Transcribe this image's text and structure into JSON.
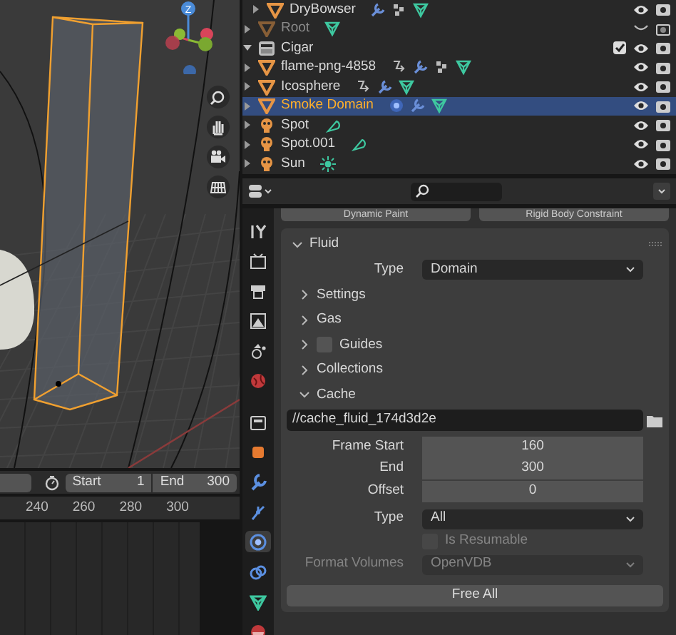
{
  "viewport": {
    "gizmo_label": "Z"
  },
  "timeline": {
    "start_label": "Start",
    "start": "1",
    "end_label": "End",
    "end": "300",
    "ruler": [
      "240",
      "260",
      "280",
      "300"
    ]
  },
  "outliner": [
    {
      "kind": "cut_off",
      "children": [
        {
          "kind": "cut_off",
          "children": [
            {
              "name": "DryBowser",
              "kind": "mesh",
              "hidden": false,
              "selected": false,
              "expanded": false,
              "icons": [
                {
                  "kind": "wrench"
                },
                {
                  "kind": "particles"
                },
                {
                  "kind": "mesh"
                }
              ]
            }
          ]
        },
        {
          "name": "Root",
          "kind": "mesh",
          "hidden": true,
          "selected": false,
          "expanded": false,
          "icons": [
            {
              "kind": "mesh"
            }
          ]
        }
      ]
    },
    {
      "name": "Cigar",
      "kind": "collection",
      "hidden": false,
      "selected": false,
      "expanded": true,
      "included": true,
      "children": [
        {
          "name": "flame-png-4858",
          "kind": "mesh",
          "hidden": false,
          "selected": false,
          "expanded": false,
          "icons": [
            {
              "kind": "constraint"
            },
            {
              "kind": "wrench"
            },
            {
              "kind": "particles"
            },
            {
              "kind": "mesh"
            }
          ]
        },
        {
          "name": "Icosphere",
          "kind": "mesh",
          "hidden": false,
          "selected": false,
          "expanded": false,
          "icons": [
            {
              "kind": "constraint"
            },
            {
              "kind": "wrench"
            },
            {
              "kind": "mesh"
            }
          ]
        },
        {
          "name": "Smoke Domain",
          "kind": "mesh",
          "hidden": false,
          "selected": true,
          "expanded": false,
          "icons": [
            {
              "kind": "physics"
            },
            {
              "kind": "wrench"
            },
            {
              "kind": "mesh"
            }
          ]
        },
        {
          "name": "Spot",
          "kind": "light",
          "hidden": false,
          "selected": false,
          "expanded": false,
          "icons": [
            {
              "kind": "spot"
            }
          ]
        },
        {
          "name": "Spot.001",
          "kind": "light",
          "hidden": false,
          "selected": false,
          "expanded": false,
          "icons": [
            {
              "kind": "spot"
            }
          ]
        },
        {
          "name": "Sun",
          "kind": "light",
          "hidden": false,
          "selected": false,
          "expanded": false,
          "icons": [
            {
              "kind": "sun"
            }
          ]
        }
      ]
    }
  ],
  "properties": {
    "tabs": [
      {
        "kind": "tool",
        "selected": false
      },
      {
        "kind": "render",
        "selected": false
      },
      {
        "kind": "output",
        "selected": false
      },
      {
        "kind": "view_layer",
        "selected": false
      },
      {
        "kind": "scene",
        "selected": false
      },
      {
        "kind": "world",
        "selected": false
      },
      {
        "kind": "collection",
        "selected": false
      },
      {
        "kind": "object",
        "selected": false
      },
      {
        "kind": "modifier",
        "selected": false
      },
      {
        "kind": "particles",
        "selected": false
      },
      {
        "kind": "physics",
        "selected": true
      },
      {
        "kind": "constraint",
        "selected": false
      },
      {
        "kind": "data",
        "selected": false
      },
      {
        "kind": "material",
        "selected": false
      }
    ],
    "physics_buttons": [
      "Dynamic Paint",
      "Rigid Body Constraint"
    ],
    "panel": {
      "title": "Fluid",
      "expanded": true,
      "type_label": "Type",
      "type_value": "Domain",
      "subpanels": [
        {
          "label": "Settings",
          "expanded": false
        },
        {
          "label": "Gas",
          "expanded": false
        },
        {
          "label": "Guides",
          "expanded": false,
          "checked": false
        },
        {
          "label": "Collections",
          "expanded": false
        },
        {
          "label": "Cache",
          "expanded": true
        }
      ],
      "cache": {
        "path": "//cache_fluid_174d3d2e",
        "fields": [
          {
            "label": "Frame Start",
            "value": "160"
          },
          {
            "label": "End",
            "value": "300"
          },
          {
            "label": "Offset",
            "value": "0"
          }
        ],
        "type_label": "Type",
        "type_value": "All",
        "resumable": {
          "label": "Is Resumable",
          "checked": false,
          "disabled": true
        },
        "format": {
          "label": "Format Volumes",
          "value": "OpenVDB",
          "disabled": true
        },
        "free_button": "Free All"
      }
    }
  }
}
